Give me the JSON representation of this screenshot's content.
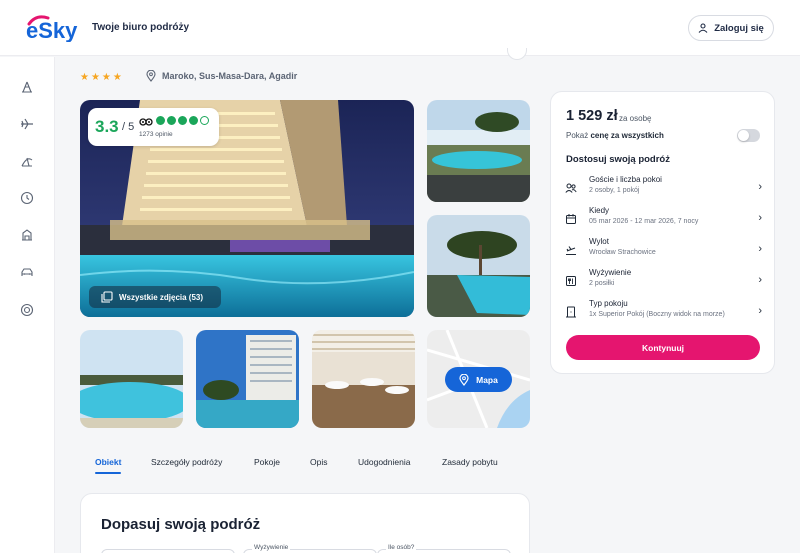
{
  "header": {
    "tagline": "Twoje biuro podróży",
    "login_label": "Zaloguj się"
  },
  "sidebar": {
    "items": [
      {
        "icon": "beach-icon"
      },
      {
        "icon": "plane-icon"
      },
      {
        "icon": "vacation-icon"
      },
      {
        "icon": "last-minute-icon"
      },
      {
        "icon": "hotel-icon"
      },
      {
        "icon": "car-icon"
      },
      {
        "icon": "support-icon"
      }
    ]
  },
  "hotel": {
    "stars": "★★★★",
    "location": "Maroko, Sus-Masa-Dara, Agadir"
  },
  "rating": {
    "score": "3.3",
    "max": "/ 5",
    "reviews": "1273 opinie",
    "filled_dots": 4,
    "total_dots": 5
  },
  "gallery": {
    "all_photos_label": "Wszystkie zdjęcia (53)",
    "map_label": "Mapa"
  },
  "tabs": [
    {
      "label": "Obiekt",
      "active": true
    },
    {
      "label": "Szczegóły podróży"
    },
    {
      "label": "Pokoje"
    },
    {
      "label": "Opis"
    },
    {
      "label": "Udogodnienia"
    },
    {
      "label": "Zasady pobytu"
    }
  ],
  "fit": {
    "title": "Dopasuj swoją podróż",
    "field2_label": "Wyżywienie",
    "field3_label": "Ile osób?"
  },
  "booking": {
    "price": "1 529 zł",
    "price_unit": "za osobę",
    "show_all_prefix": "Pokaż",
    "show_all_bold": "cenę za wszystkich",
    "section_title": "Dostosuj swoją podróż",
    "options": [
      {
        "title": "Goście i liczba pokoi",
        "sub": "2 osoby, 1 pokój",
        "icon": "guests-icon"
      },
      {
        "title": "Kiedy",
        "sub": "05 mar 2026 - 12 mar 2026, 7 nocy",
        "icon": "calendar-icon"
      },
      {
        "title": "Wylot",
        "sub": "Wrocław Strachowice",
        "icon": "departure-icon"
      },
      {
        "title": "Wyżywienie",
        "sub": "2 posiłki",
        "icon": "meal-icon"
      },
      {
        "title": "Typ pokoju",
        "sub": "1x Superior Pokój (Boczny widok na morze)",
        "icon": "room-icon"
      }
    ],
    "continue_label": "Kontynuuj"
  },
  "colors": {
    "accent_blue": "#1565d8",
    "brand_pink": "#e5156f",
    "rating_green": "#1ba65a",
    "star_orange": "#f6a623"
  }
}
